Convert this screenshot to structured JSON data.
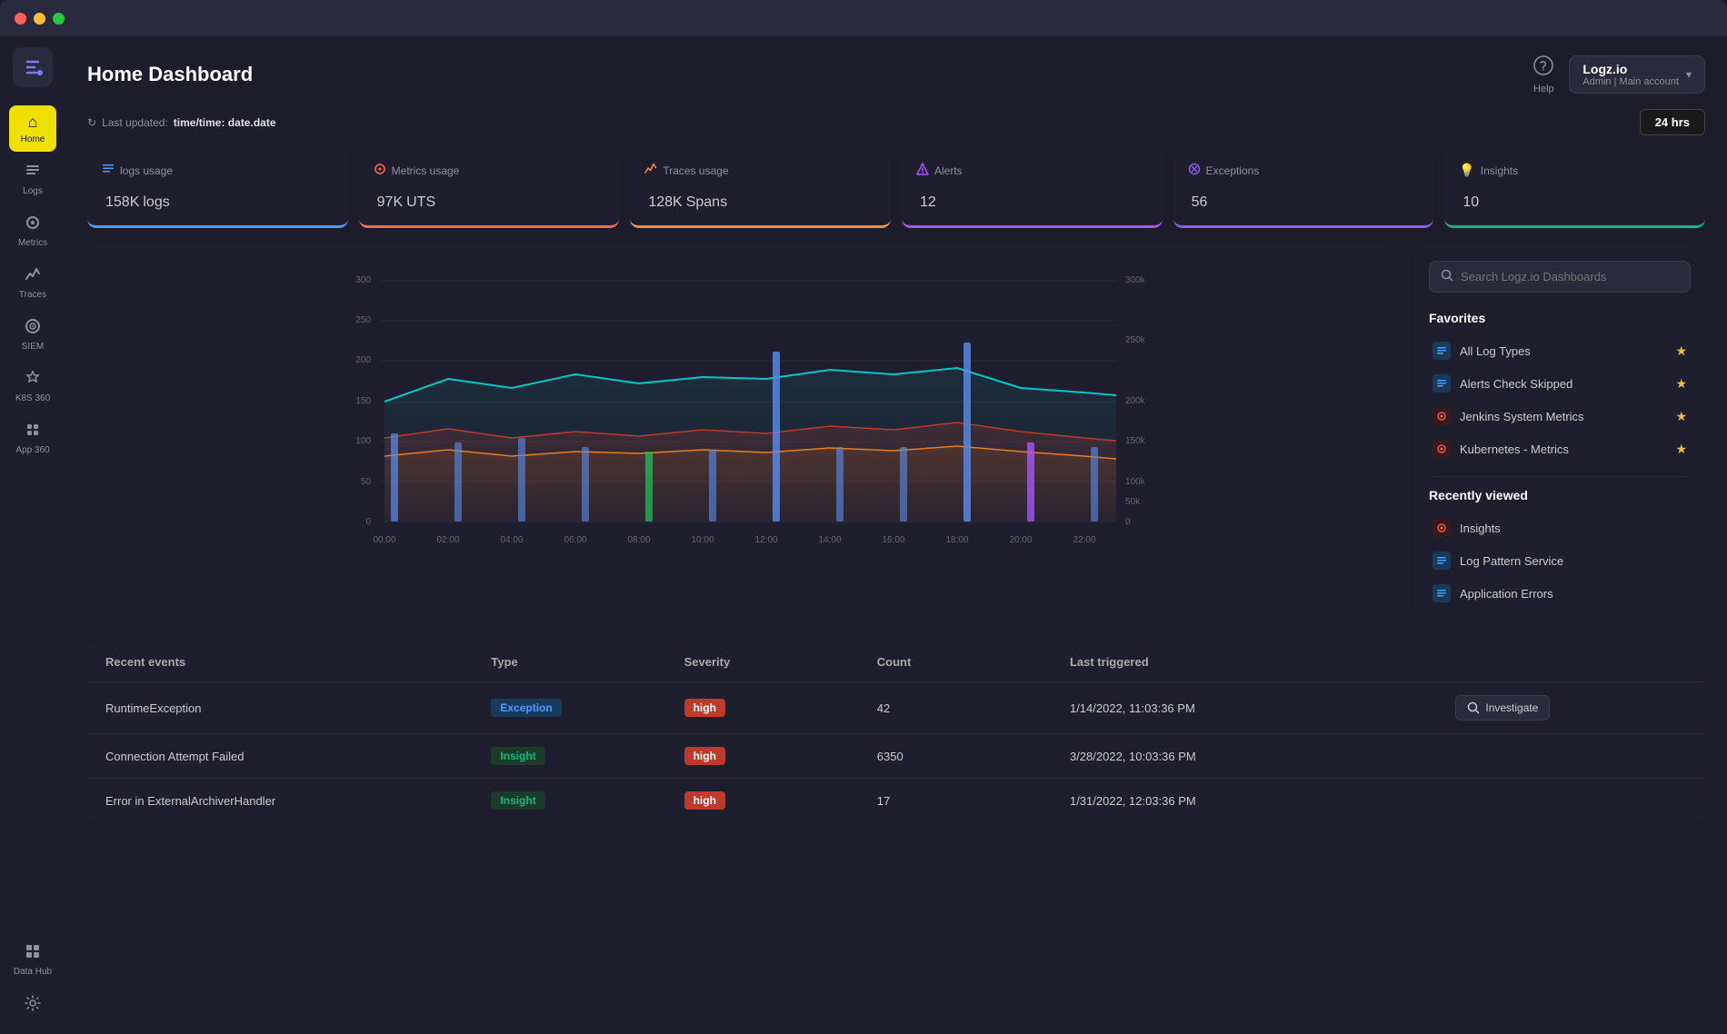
{
  "window": {
    "title": "Logz.io Home Dashboard"
  },
  "header": {
    "title": "Home Dashboard",
    "last_updated_label": "Last updated:",
    "last_updated_value": "time/time: date.date",
    "time_filter": "24 hrs"
  },
  "account": {
    "name": "Logz.io",
    "role": "Admin",
    "account_type": "Main account"
  },
  "help": {
    "label": "Help"
  },
  "metric_cards": [
    {
      "id": "logs",
      "icon": "≡",
      "label": "logs usage",
      "value": "158K",
      "unit": "logs",
      "color": "#4a9eff",
      "card_class": "logs"
    },
    {
      "id": "metrics",
      "icon": "◎",
      "label": "Metrics usage",
      "value": "97K",
      "unit": "UTS",
      "color": "#ff6b4a",
      "card_class": "metrics"
    },
    {
      "id": "traces",
      "icon": "⇒",
      "label": "Traces usage",
      "value": "128K",
      "unit": "Spans",
      "color": "#ff8c42",
      "card_class": "traces"
    },
    {
      "id": "alerts",
      "icon": "◇",
      "label": "Alerts",
      "value": "12",
      "unit": "",
      "color": "#a855f7",
      "card_class": "alerts"
    },
    {
      "id": "exceptions",
      "icon": "⊘",
      "label": "Exceptions",
      "value": "56",
      "unit": "",
      "color": "#8b5cf6",
      "card_class": "exceptions"
    },
    {
      "id": "insights",
      "icon": "💡",
      "label": "Insights",
      "value": "10",
      "unit": "",
      "color": "#10b981",
      "card_class": "insights"
    }
  ],
  "chart": {
    "x_labels": [
      "00:00",
      "02:00",
      "04:00",
      "06:00",
      "08:00",
      "10:00",
      "12:00",
      "14:00",
      "16:00",
      "18:00",
      "20:00",
      "22:00"
    ],
    "y_left_labels": [
      "0",
      "50",
      "100",
      "150",
      "200",
      "250",
      "300"
    ],
    "y_right_labels": [
      "0",
      "50k",
      "100k",
      "150k",
      "200k",
      "250k",
      "300k"
    ]
  },
  "dashboard_panel": {
    "search_placeholder": "Search Logz.io Dashboards",
    "favorites_title": "Favorites",
    "favorites": [
      {
        "id": "all-log-types",
        "icon_type": "logs",
        "label": "All Log Types",
        "starred": true
      },
      {
        "id": "alerts-check-skipped",
        "icon_type": "logs",
        "label": "Alerts Check Skipped",
        "starred": true
      },
      {
        "id": "jenkins-system-metrics",
        "icon_type": "metrics",
        "label": "Jenkins System Metrics",
        "starred": true
      },
      {
        "id": "kubernetes-metrics",
        "icon_type": "metrics",
        "label": "Kubernetes - Metrics",
        "starred": true
      }
    ],
    "recently_viewed_title": "Recently viewed",
    "recently_viewed": [
      {
        "id": "insights",
        "icon_type": "insights",
        "label": "Insights"
      },
      {
        "id": "log-pattern-service",
        "icon_type": "logs",
        "label": "Log Pattern Service"
      },
      {
        "id": "application-errors",
        "icon_type": "logs",
        "label": "Application Errors"
      }
    ]
  },
  "events_table": {
    "title": "Recent events",
    "columns": [
      "Recent events",
      "Type",
      "Severity",
      "Count",
      "Last triggered",
      ""
    ],
    "rows": [
      {
        "name": "RuntimeException",
        "type": "Exception",
        "type_class": "exception",
        "severity": "high",
        "count": "42",
        "last_triggered": "1/14/2022, 11:03:36 PM",
        "action": "Investigate"
      },
      {
        "name": "Connection Attempt Failed",
        "type": "Insight",
        "type_class": "insight",
        "severity": "high",
        "count": "6350",
        "last_triggered": "3/28/2022, 10:03:36 PM",
        "action": ""
      },
      {
        "name": "Error in ExternalArchiverHandler",
        "type": "Insight",
        "type_class": "insight",
        "severity": "high",
        "count": "17",
        "last_triggered": "1/31/2022, 12:03:36 PM",
        "action": ""
      }
    ]
  },
  "sidebar": {
    "items": [
      {
        "id": "home",
        "icon": "⌂",
        "label": "Home",
        "active": true
      },
      {
        "id": "logs",
        "icon": "≡",
        "label": "Logs",
        "active": false
      },
      {
        "id": "metrics",
        "icon": "◎",
        "label": "Metrics",
        "active": false
      },
      {
        "id": "traces",
        "icon": "⇒",
        "label": "Traces",
        "active": false
      },
      {
        "id": "siem",
        "icon": "◉",
        "label": "SIEM",
        "active": false
      },
      {
        "id": "k8s360",
        "icon": "✦",
        "label": "K8S 360",
        "active": false
      },
      {
        "id": "app360",
        "icon": "✦",
        "label": "App 360",
        "active": false
      }
    ],
    "bottom_items": [
      {
        "id": "data-hub",
        "icon": "⊞",
        "label": "Data Hub"
      },
      {
        "id": "settings",
        "icon": "⚙",
        "label": ""
      }
    ]
  }
}
